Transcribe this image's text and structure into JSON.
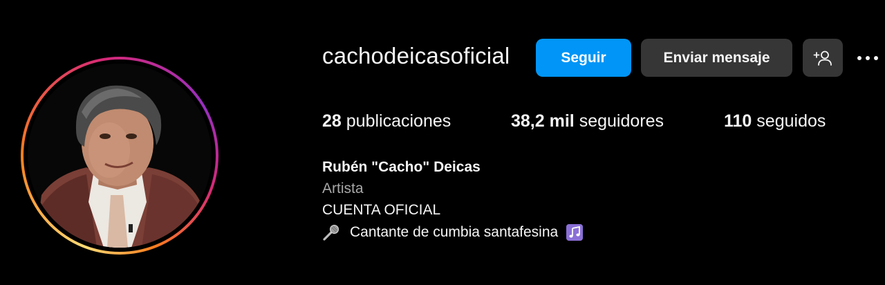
{
  "profile": {
    "username": "cachodeicasoficial",
    "full_name": "Rubén \"Cacho\" Deicas",
    "category": "Artista",
    "bio_lines": [
      "CUENTA OFICIAL",
      "Cantante de cumbia santafesina"
    ],
    "bio_icons": [
      "microphone-emoji",
      "musical-notes-emoji"
    ]
  },
  "actions": {
    "follow_label": "Seguir",
    "message_label": "Enviar mensaje",
    "add_icon": "add-person-icon",
    "more_icon": "more-options-icon"
  },
  "stats": {
    "posts_count": "28",
    "posts_label": "publicaciones",
    "followers_count": "38,2 mil",
    "followers_label": "seguidores",
    "following_count": "110",
    "following_label": "seguidos"
  },
  "colors": {
    "background": "#000000",
    "follow_button": "#0095f6",
    "secondary_button": "#363636",
    "text_primary": "#f5f5f5",
    "text_secondary": "#a8a8a8"
  }
}
